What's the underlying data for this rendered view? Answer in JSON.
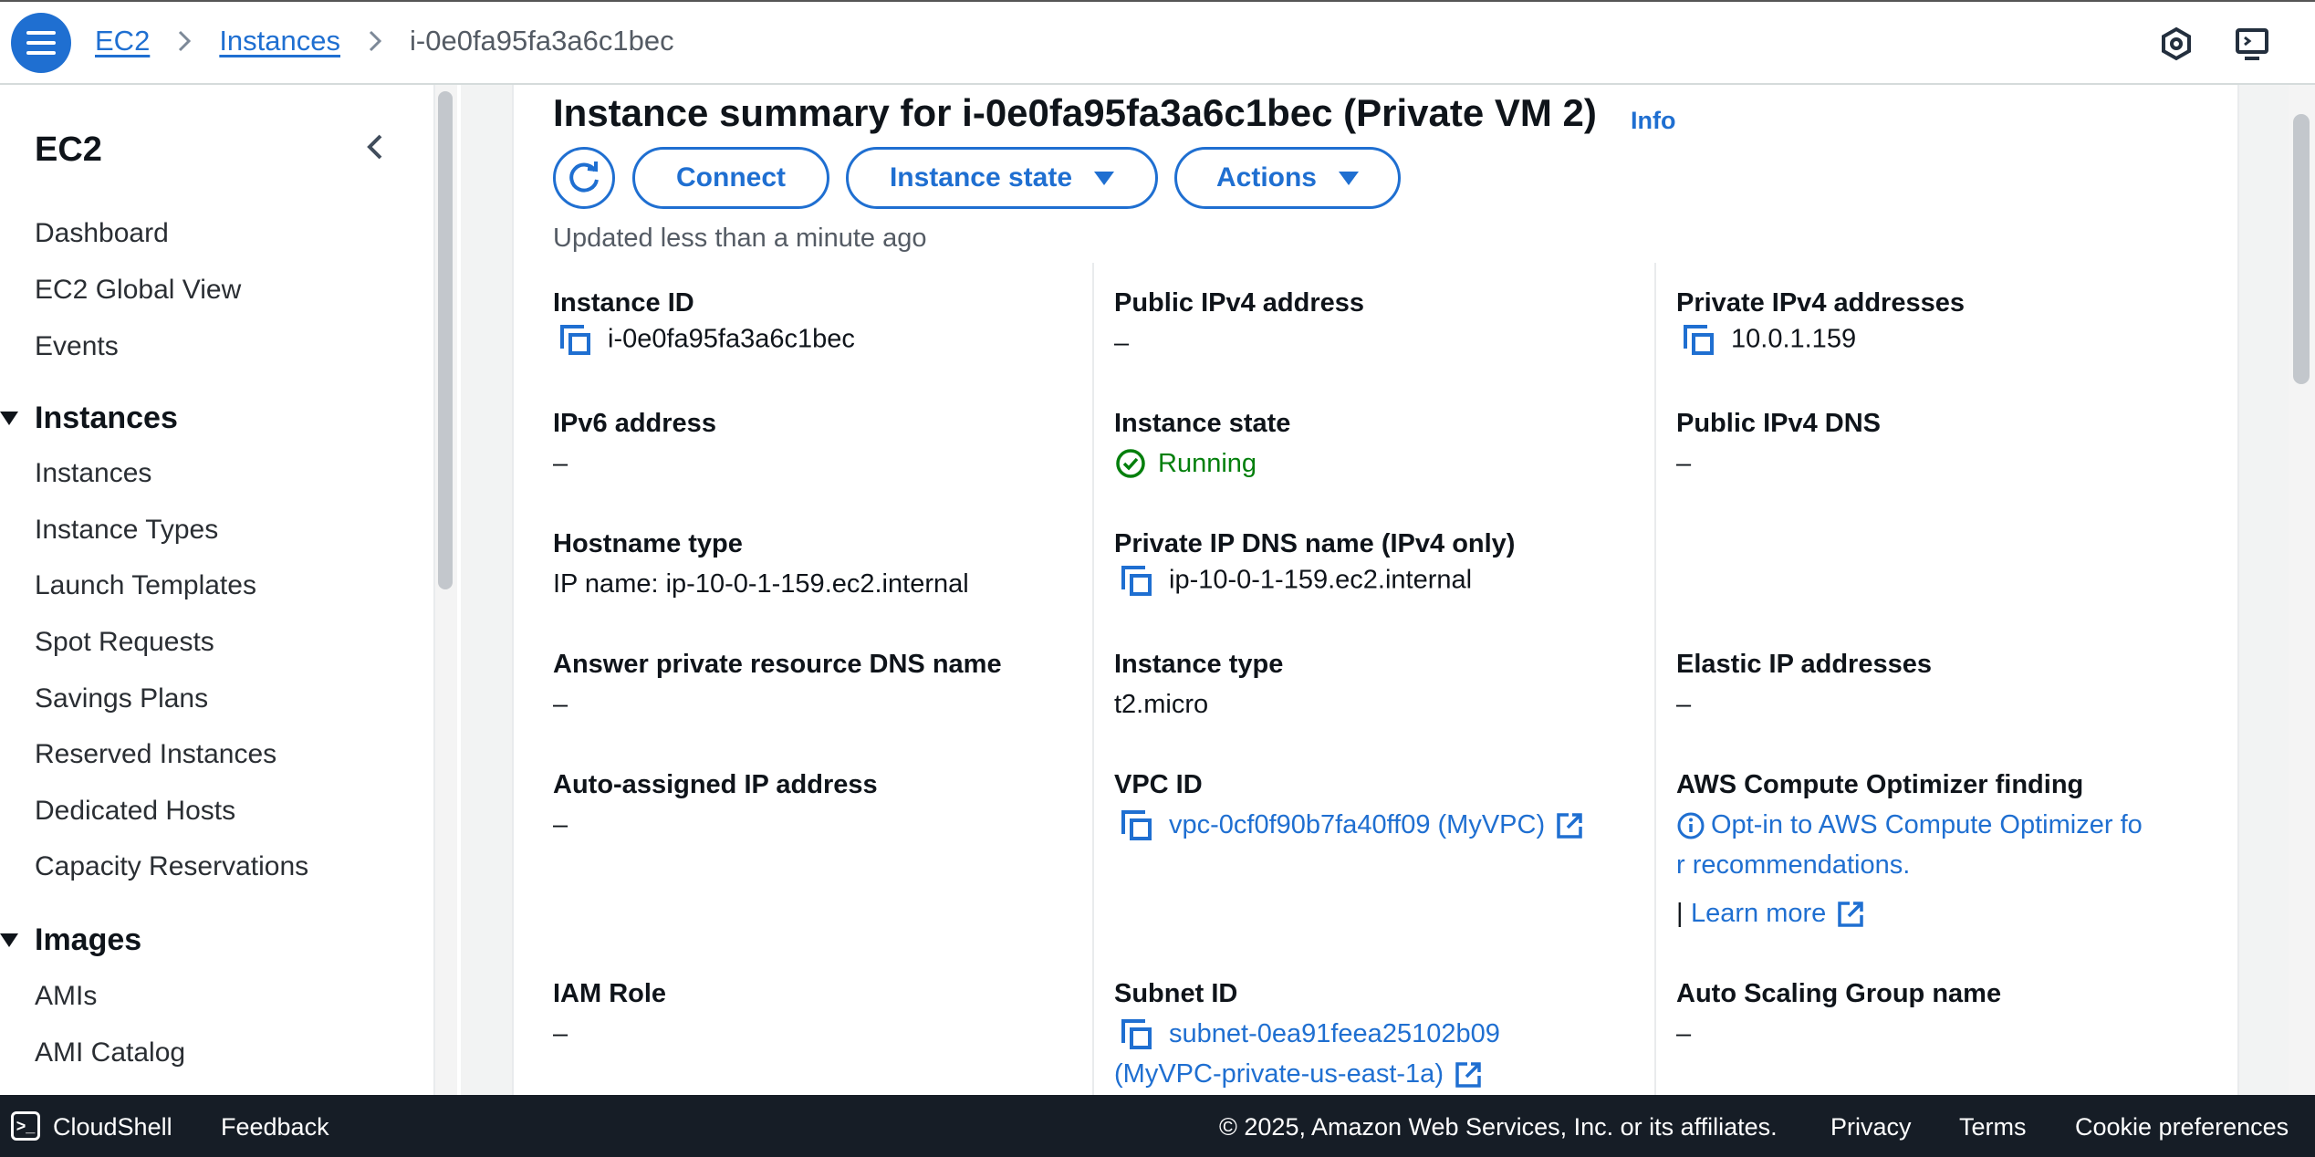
{
  "breadcrumb": {
    "service": "EC2",
    "section": "Instances",
    "current": "i-0e0fa95fa3a6c1bec"
  },
  "sidebar": {
    "title": "EC2",
    "top_links": [
      "Dashboard",
      "EC2 Global View",
      "Events"
    ],
    "sections": [
      {
        "label": "Instances",
        "items": [
          "Instances",
          "Instance Types",
          "Launch Templates",
          "Spot Requests",
          "Savings Plans",
          "Reserved Instances",
          "Dedicated Hosts",
          "Capacity Reservations"
        ]
      },
      {
        "label": "Images",
        "items": [
          "AMIs",
          "AMI Catalog"
        ]
      }
    ]
  },
  "summary": {
    "title": "Instance summary for i-0e0fa95fa3a6c1bec (Private VM 2)",
    "info": "Info",
    "buttons": {
      "connect": "Connect",
      "instance_state": "Instance state",
      "actions": "Actions"
    },
    "updated": "Updated less than a minute ago",
    "fields": {
      "instance_id": {
        "label": "Instance ID",
        "value": "i-0e0fa95fa3a6c1bec"
      },
      "public_ipv4": {
        "label": "Public IPv4 address",
        "value": "–"
      },
      "private_ipv4": {
        "label": "Private IPv4 addresses",
        "value": "10.0.1.159"
      },
      "ipv6": {
        "label": "IPv6 address",
        "value": "–"
      },
      "instance_state": {
        "label": "Instance state",
        "value": "Running"
      },
      "public_dns": {
        "label": "Public IPv4 DNS",
        "value": "–"
      },
      "hostname_type": {
        "label": "Hostname type",
        "value": "IP name: ip-10-0-1-159.ec2.internal"
      },
      "private_dns": {
        "label": "Private IP DNS name (IPv4 only)",
        "value": "ip-10-0-1-159.ec2.internal"
      },
      "answer_dns": {
        "label": "Answer private resource DNS name",
        "value": "–"
      },
      "instance_type": {
        "label": "Instance type",
        "value": "t2.micro"
      },
      "elastic_ip": {
        "label": "Elastic IP addresses",
        "value": "–"
      },
      "auto_ip": {
        "label": "Auto-assigned IP address",
        "value": "–"
      },
      "vpc_id": {
        "label": "VPC ID",
        "value": "vpc-0cf0f90b7fa40ff09 (MyVPC)"
      },
      "optimizer": {
        "label": "AWS Compute Optimizer finding",
        "line1": "Opt-in to AWS Compute Optimizer fo",
        "line2": "r recommendations.",
        "sep": "|",
        "learn_more": "Learn more"
      },
      "iam_role": {
        "label": "IAM Role",
        "value": "–"
      },
      "subnet_id": {
        "label": "Subnet ID",
        "line1": "subnet-0ea91feea25102b09",
        "line2": "(MyVPC-private-us-east-1a)"
      },
      "asg_name": {
        "label": "Auto Scaling Group name",
        "value": "–"
      }
    }
  },
  "footer": {
    "cloudshell": "CloudShell",
    "feedback": "Feedback",
    "copyright": "© 2025, Amazon Web Services, Inc. or its affiliates.",
    "privacy": "Privacy",
    "terms": "Terms",
    "cookies": "Cookie preferences"
  },
  "colors": {
    "link": "#1f6fd1",
    "running": "#037f0c",
    "footer_bg": "#161d26"
  }
}
